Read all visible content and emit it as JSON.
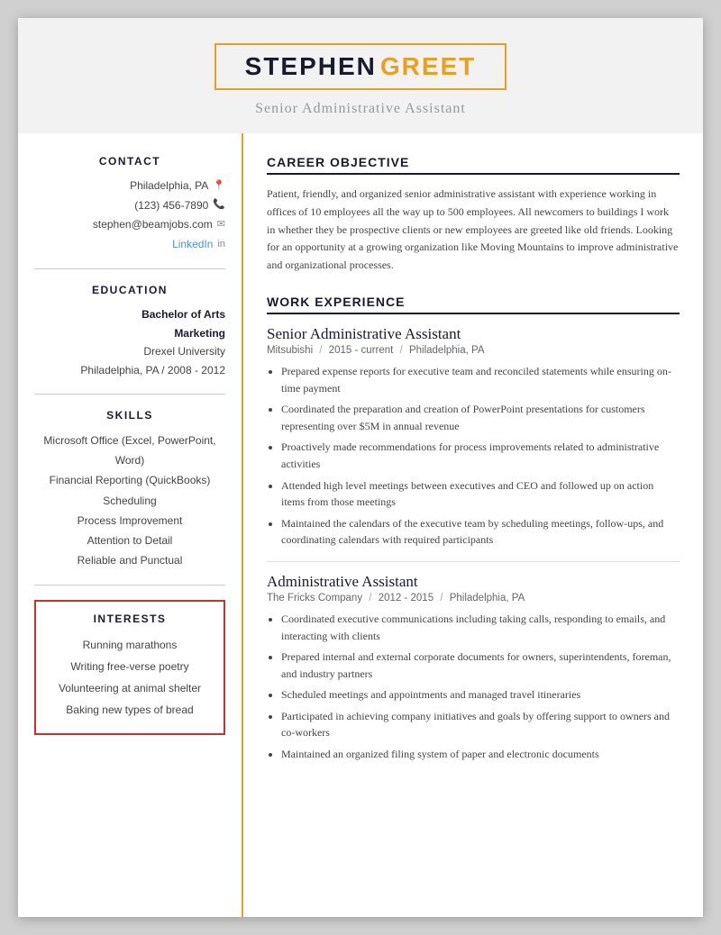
{
  "header": {
    "first_name": "STEPHEN",
    "last_name": "GREET",
    "title": "Senior Administrative Assistant"
  },
  "contact": {
    "heading": "CONTACT",
    "location": "Philadelphia, PA",
    "phone": "(123) 456-7890",
    "email": "stephen@beamjobs.com",
    "linkedin_label": "LinkedIn"
  },
  "education": {
    "heading": "EDUCATION",
    "degree_line1": "Bachelor of Arts",
    "degree_line2": "Marketing",
    "school": "Drexel University",
    "location_years": "Philadelphia, PA  /  2008 - 2012"
  },
  "skills": {
    "heading": "SKILLS",
    "items": [
      "Microsoft Office (Excel, PowerPoint, Word)",
      "Financial Reporting (QuickBooks)",
      "Scheduling",
      "Process Improvement",
      "Attention to Detail",
      "Reliable and Punctual"
    ]
  },
  "interests": {
    "heading": "INTERESTS",
    "items": [
      "Running marathons",
      "Writing free-verse poetry",
      "Volunteering at animal shelter",
      "Baking new types of bread"
    ]
  },
  "career_objective": {
    "heading": "CAREER OBJECTIVE",
    "text": "Patient, friendly, and organized senior administrative assistant with experience working in offices of 10 employees all the way up to 500 employees. All newcomers to buildings I work in whether they be prospective clients or new employees are greeted like old friends. Looking for an opportunity at a growing organization like Moving Mountains to improve administrative and organizational processes."
  },
  "work_experience": {
    "heading": "WORK EXPERIENCE",
    "jobs": [
      {
        "title": "Senior Administrative Assistant",
        "company": "Mitsubishi",
        "years": "2015 - current",
        "location": "Philadelphia, PA",
        "bullets": [
          "Prepared expense reports for executive team and reconciled statements while ensuring on-time payment",
          "Coordinated the preparation and creation of PowerPoint presentations for customers representing over $5M in annual revenue",
          "Proactively made recommendations for process improvements related to administrative activities",
          "Attended high level meetings between executives and CEO and followed up on action items from those meetings",
          "Maintained the calendars of the executive team by scheduling meetings, follow-ups, and coordinating calendars with required participants"
        ]
      },
      {
        "title": "Administrative Assistant",
        "company": "The Fricks Company",
        "years": "2012 - 2015",
        "location": "Philadelphia, PA",
        "bullets": [
          "Coordinated executive communications including taking calls, responding to emails, and interacting with clients",
          "Prepared internal and external corporate documents for owners, superintendents, foreman, and industry partners",
          "Scheduled meetings and appointments and managed travel itineraries",
          "Participated in achieving company initiatives and goals by offering support to owners and co-workers",
          "Maintained an organized filing system of paper and electronic documents"
        ]
      }
    ]
  }
}
